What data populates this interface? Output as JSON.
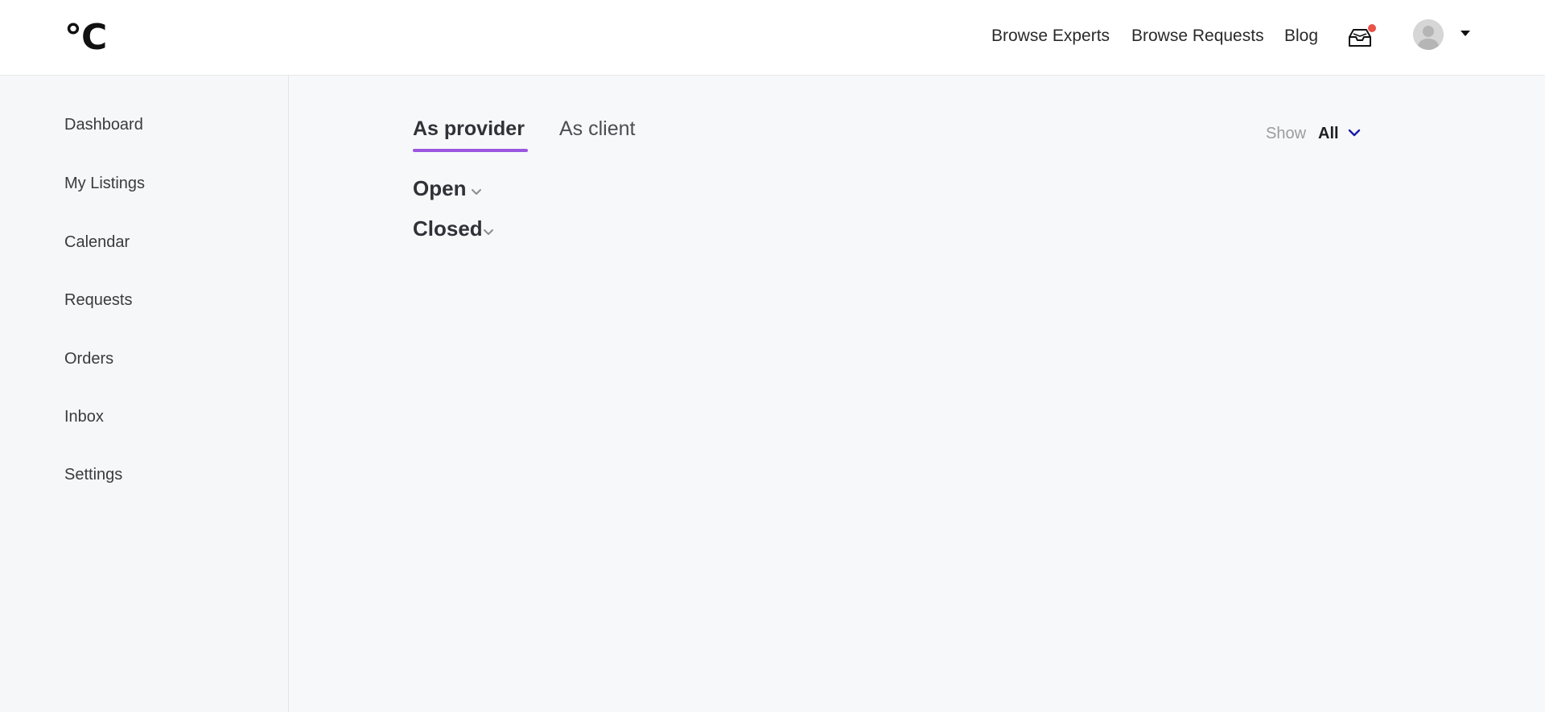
{
  "header": {
    "logo_text": "°C",
    "nav": [
      {
        "label": "Browse Experts"
      },
      {
        "label": "Browse Requests"
      },
      {
        "label": "Blog"
      }
    ],
    "inbox_icon": "inbox-tray-icon",
    "notification_color": "#e8534a"
  },
  "sidebar": {
    "items": [
      {
        "label": "Dashboard"
      },
      {
        "label": "My Listings"
      },
      {
        "label": "Calendar"
      },
      {
        "label": "Requests"
      },
      {
        "label": "Orders"
      },
      {
        "label": "Inbox"
      },
      {
        "label": "Settings"
      }
    ]
  },
  "main": {
    "tabs": [
      {
        "label": "As provider",
        "active": true
      },
      {
        "label": "As client",
        "active": false
      }
    ],
    "accent_color": "#9b57e0",
    "filter": {
      "label": "Show",
      "value": "All"
    },
    "sections": [
      {
        "label": "Open"
      },
      {
        "label": "Closed"
      }
    ]
  }
}
